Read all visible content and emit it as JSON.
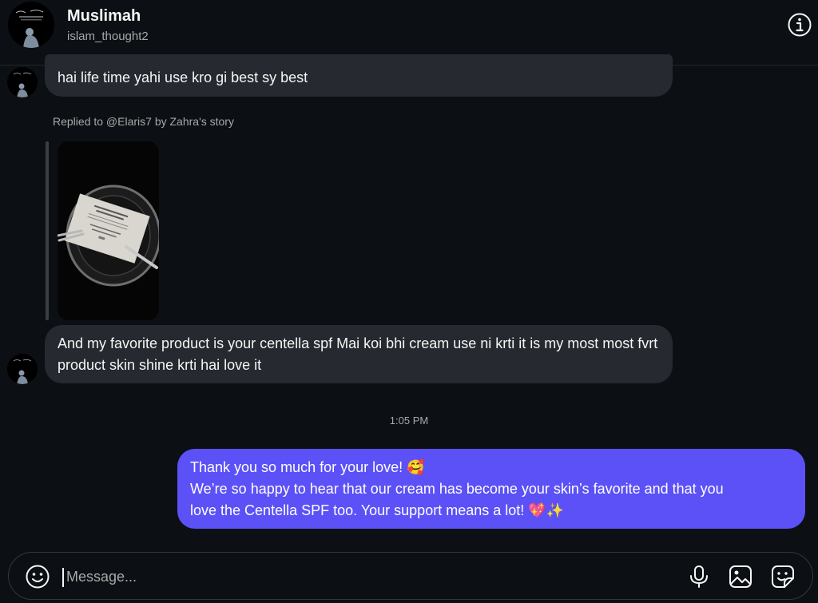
{
  "header": {
    "name": "Muslimah",
    "handle": "islam_thought2"
  },
  "messages": {
    "incoming_top": "hai life time yahi use kro gi best sy best",
    "reply_context": "Replied to @Elaris7 by Zahra's story",
    "incoming_favorite": "And my favorite product is your centella spf Mai koi bhi cream use ni krti it is my most most fvrt product skin shine krti hai love it",
    "timestamp": "1:05 PM",
    "outgoing": {
      "line1": "Thank you so much for your love! 🥰",
      "line2": "We’re so happy to hear that our cream has become your skin’s favorite and that you",
      "line3": "love the Centella SPF too. Your support means a lot! 💖✨"
    }
  },
  "composer": {
    "placeholder": "Message..."
  },
  "icons": {
    "header": [
      "info-icon"
    ],
    "composer": [
      "emoji-icon",
      "microphone-icon",
      "image-icon",
      "sticker-icon"
    ]
  },
  "colors": {
    "background": "#0c1014",
    "incoming_bubble": "#262a30",
    "outgoing_bubble": "#5b51f6",
    "secondary_text": "#a8a8a8"
  }
}
